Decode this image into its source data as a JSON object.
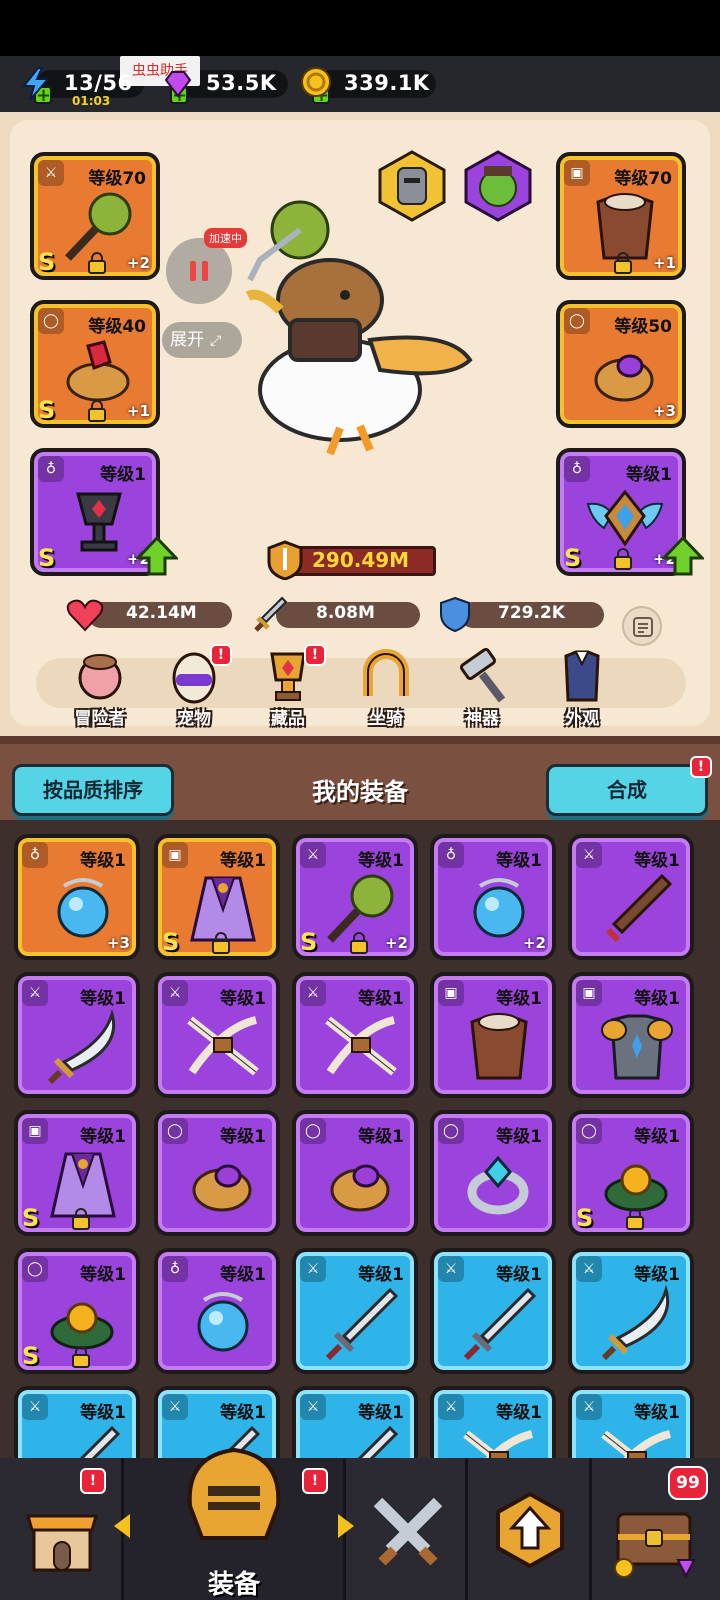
{
  "resources": {
    "energy": {
      "value": "13/56",
      "timer": "01:03",
      "icon": "lightning-icon"
    },
    "gems": {
      "value": "53.5K",
      "icon": "gem-icon"
    },
    "gold": {
      "value": "339.1K",
      "icon": "gold-coin-icon"
    }
  },
  "overlay": {
    "helper_label": "虫虫助手",
    "accelerating": "加速中",
    "expand": "展开"
  },
  "hero_slots": {
    "weapon": {
      "level": "等级70",
      "plus": "+2",
      "grade": "S",
      "icon": "spiked-mace-icon",
      "rarity": "orange"
    },
    "armor": {
      "level": "等级70",
      "plus": "+1",
      "grade": "",
      "icon": "fur-armor-icon",
      "rarity": "orange"
    },
    "ring_left": {
      "level": "等级40",
      "plus": "+1",
      "grade": "S",
      "icon": "ruby-ring-icon",
      "rarity": "orange"
    },
    "ring_right": {
      "level": "等级50",
      "plus": "+3",
      "grade": "",
      "icon": "amethyst-ring-icon",
      "rarity": "orange"
    },
    "necklace": {
      "level": "等级1",
      "plus": "+2",
      "grade": "S",
      "icon": "dark-chalice-icon",
      "rarity": "purple"
    },
    "amulet": {
      "level": "等级1",
      "plus": "+2",
      "grade": "S",
      "icon": "winged-shield-icon",
      "rarity": "purple"
    }
  },
  "hero": {
    "power": "290.49M",
    "hp": "42.14M",
    "attack": "8.08M",
    "defense": "729.2K"
  },
  "menu": [
    {
      "label": "冒险者",
      "icon": "adventurer-icon",
      "badge": ""
    },
    {
      "label": "宠物",
      "icon": "pet-egg-icon",
      "badge": "!"
    },
    {
      "label": "藏品",
      "icon": "trophy-icon",
      "badge": "!"
    },
    {
      "label": "坐骑",
      "icon": "horseshoe-icon",
      "badge": ""
    },
    {
      "label": "神器",
      "icon": "hammer-icon",
      "badge": ""
    },
    {
      "label": "外观",
      "icon": "outfit-icon",
      "badge": ""
    }
  ],
  "equipment": {
    "sort_button": "按品质排序",
    "title": "我的装备",
    "merge_button": "合成",
    "merge_badge": "!",
    "items": [
      {
        "level": "等级1",
        "plus": "+3",
        "grade": "",
        "rarity": "orange",
        "icon": "blue-orb-necklace-icon",
        "lock": false
      },
      {
        "level": "等级1",
        "plus": "",
        "grade": "S",
        "rarity": "orange",
        "icon": "purple-cloak-icon",
        "lock": true
      },
      {
        "level": "等级1",
        "plus": "+2",
        "grade": "S",
        "rarity": "purple",
        "icon": "spiked-mace-icon",
        "lock": true
      },
      {
        "level": "等级1",
        "plus": "+2",
        "grade": "",
        "rarity": "purple",
        "icon": "blue-orb-necklace-icon",
        "lock": false
      },
      {
        "level": "等级1",
        "plus": "",
        "grade": "",
        "rarity": "purple",
        "icon": "wooden-sword-icon",
        "lock": false
      },
      {
        "level": "等级1",
        "plus": "",
        "grade": "",
        "rarity": "purple",
        "icon": "scimitar-icon",
        "lock": false
      },
      {
        "level": "等级1",
        "plus": "",
        "grade": "",
        "rarity": "purple",
        "icon": "bone-crossbow-icon",
        "lock": false
      },
      {
        "level": "等级1",
        "plus": "",
        "grade": "",
        "rarity": "purple",
        "icon": "bone-crossbow-icon",
        "lock": false
      },
      {
        "level": "等级1",
        "plus": "",
        "grade": "",
        "rarity": "purple",
        "icon": "fur-armor-icon",
        "lock": false
      },
      {
        "level": "等级1",
        "plus": "",
        "grade": "",
        "rarity": "purple",
        "icon": "steel-armor-icon",
        "lock": false
      },
      {
        "level": "等级1",
        "plus": "",
        "grade": "S",
        "rarity": "purple",
        "icon": "purple-cloak-icon",
        "lock": true
      },
      {
        "level": "等级1",
        "plus": "",
        "grade": "",
        "rarity": "purple",
        "icon": "amethyst-ring-icon",
        "lock": false
      },
      {
        "level": "等级1",
        "plus": "",
        "grade": "",
        "rarity": "purple",
        "icon": "amethyst-ring-icon",
        "lock": false
      },
      {
        "level": "等级1",
        "plus": "",
        "grade": "",
        "rarity": "purple",
        "icon": "crystal-ring-icon",
        "lock": false
      },
      {
        "level": "等级1",
        "plus": "",
        "grade": "S",
        "rarity": "purple",
        "icon": "amber-ring-icon",
        "lock": true
      },
      {
        "level": "等级1",
        "plus": "",
        "grade": "S",
        "rarity": "purple",
        "icon": "amber-ring-icon",
        "lock": true
      },
      {
        "level": "等级1",
        "plus": "",
        "grade": "",
        "rarity": "purple",
        "icon": "blue-orb-necklace-icon",
        "lock": false
      },
      {
        "level": "等级1",
        "plus": "",
        "grade": "",
        "rarity": "blue",
        "icon": "steel-sword-icon",
        "lock": false
      },
      {
        "level": "等级1",
        "plus": "",
        "grade": "",
        "rarity": "blue",
        "icon": "steel-sword-icon",
        "lock": false
      },
      {
        "level": "等级1",
        "plus": "",
        "grade": "",
        "rarity": "blue",
        "icon": "scimitar-icon",
        "lock": false
      },
      {
        "level": "等级1",
        "plus": "",
        "grade": "",
        "rarity": "blue",
        "icon": "steel-sword-icon",
        "lock": false
      },
      {
        "level": "等级1",
        "plus": "",
        "grade": "",
        "rarity": "blue",
        "icon": "steel-sword-icon",
        "lock": false
      },
      {
        "level": "等级1",
        "plus": "",
        "grade": "",
        "rarity": "blue",
        "icon": "steel-sword-icon",
        "lock": false
      },
      {
        "level": "等级1",
        "plus": "",
        "grade": "",
        "rarity": "blue",
        "icon": "bone-crossbow-icon",
        "lock": false
      },
      {
        "level": "等级1",
        "plus": "",
        "grade": "",
        "rarity": "blue",
        "icon": "bone-crossbow-icon",
        "lock": false
      }
    ]
  },
  "nav": {
    "shop_badge": "!",
    "equip_label": "装备",
    "equip_badge": "!",
    "chest_count": "99"
  },
  "colors": {
    "orange": "#e87a32",
    "purple": "#9b44dd",
    "blue": "#2eb4e8",
    "accent_cyan": "#55d4e6"
  }
}
